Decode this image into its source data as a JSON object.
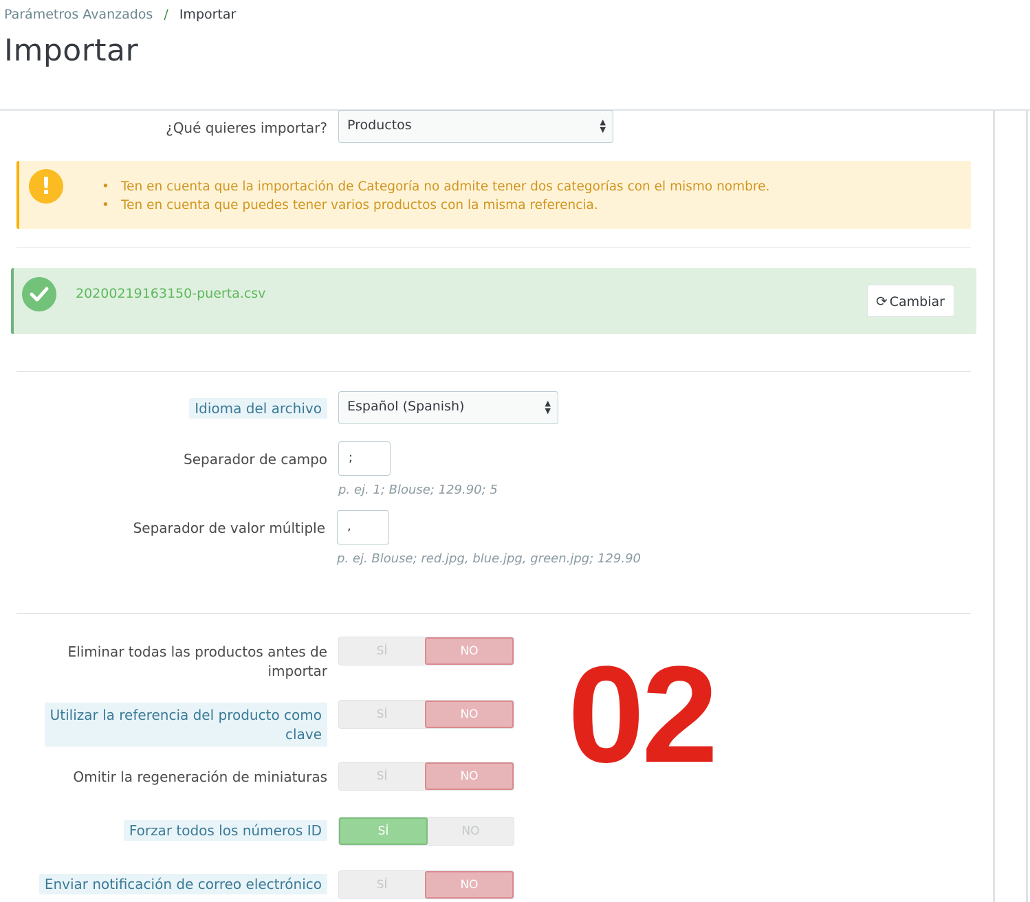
{
  "breadcrumb": {
    "parent": "Parámetros Avanzados",
    "separator": "/",
    "current": "Importar"
  },
  "page_title": "Importar",
  "import_type": {
    "label": "¿Qué quieres importar?",
    "value": "Productos"
  },
  "warning": {
    "items": [
      "Ten en cuenta que la importación de Categoría no admite tener dos categorías con el mismo nombre.",
      "Ten en cuenta que puedes tener varios productos con la misma referencia."
    ]
  },
  "file": {
    "name": "20200219163150-puerta.csv",
    "change_label": "Cambiar"
  },
  "language": {
    "label": "Idioma del archivo",
    "value": "Español (Spanish)"
  },
  "field_separator": {
    "label": "Separador de campo",
    "value": ";",
    "hint": "p. ej. 1; Blouse; 129.90; 5"
  },
  "multi_separator": {
    "label": "Separador de valor múltiple",
    "value": ",",
    "hint": "p. ej. Blouse; red.jpg, blue.jpg, green.jpg; 129.90"
  },
  "overlay_number": "02",
  "switch_labels": {
    "yes": "SÍ",
    "no": "NO"
  },
  "options": [
    {
      "label_line1": "Eliminar todas las productos antes de",
      "label_line2": "importar",
      "value": "NO"
    },
    {
      "label_line1": "Utilizar la referencia del producto como",
      "label_line2": "clave",
      "value": "NO"
    },
    {
      "label": "Omitir la regeneración de miniaturas",
      "value": "NO"
    },
    {
      "label": "Forzar todos los números ID",
      "value": "SÍ"
    },
    {
      "label": "Enviar notificación de correo electrónico",
      "value": "NO"
    }
  ],
  "colors": {
    "warning_bg": "#fff3d7",
    "success_bg": "#e0f0e0",
    "switch_no": "#e7b5b8",
    "switch_yes": "#97d497",
    "overlay": "#e2231a"
  }
}
